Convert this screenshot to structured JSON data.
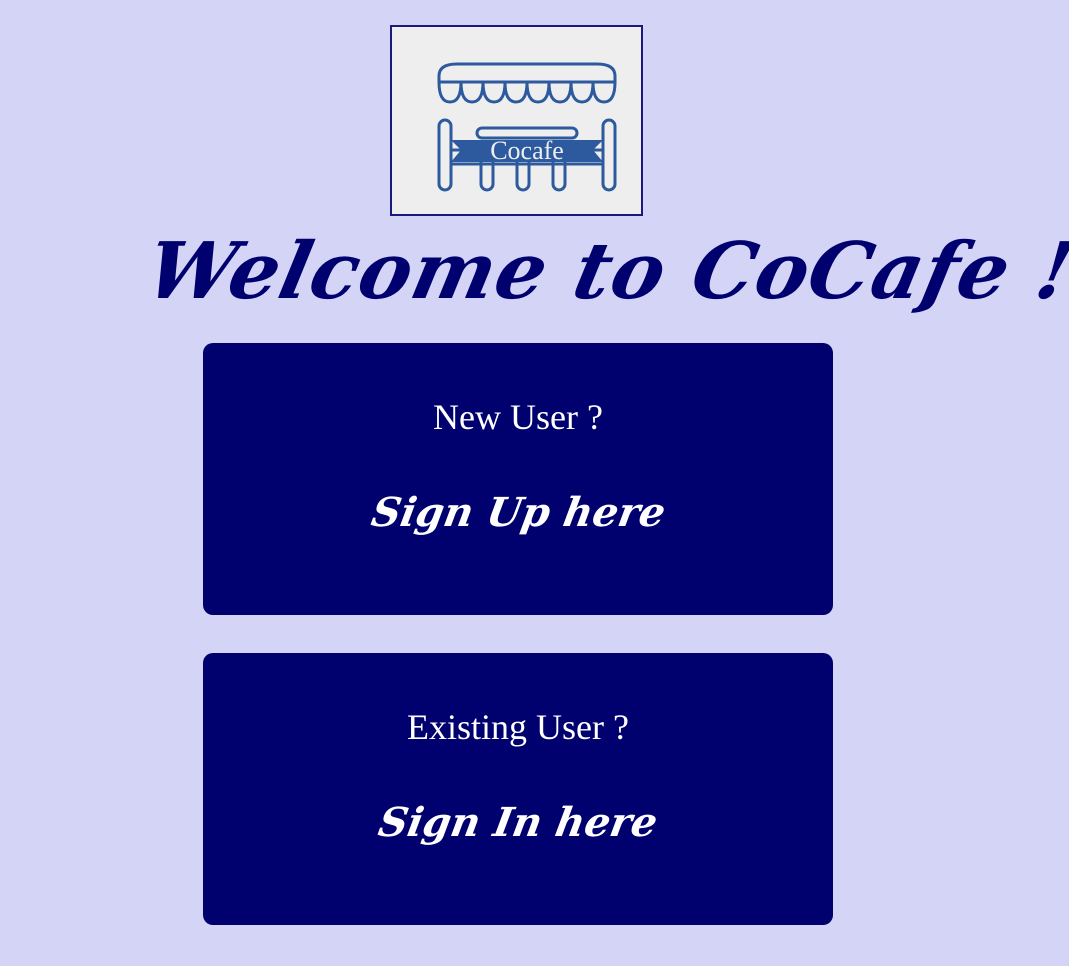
{
  "logo": {
    "text": "Cocafe",
    "color": "#2d5a9e"
  },
  "welcome": {
    "title": "Welcome to CoCafe !!"
  },
  "signup_card": {
    "question": "New User ?",
    "action": "Sign Up here"
  },
  "signin_card": {
    "question": "Existing User ?",
    "action": "Sign In here"
  },
  "colors": {
    "background": "#d4d4f7",
    "primary": "#00006e",
    "card_text": "#ffffff"
  }
}
